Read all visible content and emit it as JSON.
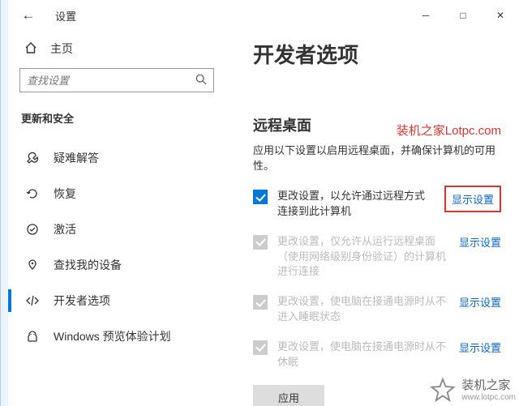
{
  "window": {
    "title": "设置",
    "minimize": "─",
    "maximize": "□",
    "close": "✕",
    "back": "←"
  },
  "sidebar": {
    "home": "主页",
    "search_placeholder": "查找设置",
    "category": "更新和安全",
    "items": [
      {
        "label": "疑难解答"
      },
      {
        "label": "恢复"
      },
      {
        "label": "激活"
      },
      {
        "label": "查找我的设备"
      },
      {
        "label": "开发者选项"
      },
      {
        "label": "Windows 预览体验计划"
      }
    ]
  },
  "main": {
    "page_title": "开发者选项",
    "section_title": "远程桌面",
    "section_desc": "应用以下设置以启用远程桌面，并确保计算机的可用性。",
    "rows": [
      {
        "text": "更改设置，以允许通过远程方式连接到此计算机",
        "link": "显示设置"
      },
      {
        "text": "更改设置，仅允许从运行远程桌面（使用网络级别身份验证）的计算机进行连接",
        "link": "显示设置"
      },
      {
        "text": "更改设置，使电脑在接通电源时从不进入睡眠状态",
        "link": "显示设置"
      },
      {
        "text": "更改设置，使电脑在接通电源时从不休眠",
        "link": "显示设置"
      }
    ],
    "apply_label": "应用"
  },
  "watermark": {
    "text": "装机之家Lotpc.com",
    "brand": "装机之家",
    "url": "www.lotpc.com"
  }
}
